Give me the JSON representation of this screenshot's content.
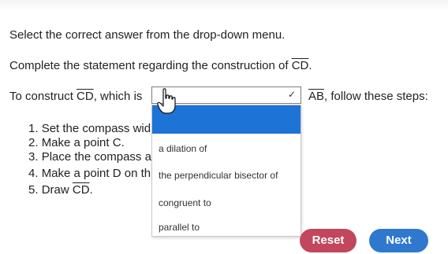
{
  "question": {
    "instruction": "Select the correct answer from the drop-down menu.",
    "statement_prefix": "Complete the statement regarding the construction of ",
    "statement_segment": "CD",
    "statement_suffix": ".",
    "sentence_prefix": "To construct ",
    "sentence_segment": "CD",
    "sentence_mid": ", which is",
    "sentence_segment2": "AB",
    "sentence_suffix": ", follow these steps:"
  },
  "steps": [
    {
      "num": "1.",
      "text": "Set the compass wid"
    },
    {
      "num": "2.",
      "text": "Make a point C."
    },
    {
      "num": "3.",
      "text": "Place the compass a"
    },
    {
      "num": "4.",
      "text": "Make a point D on th"
    },
    {
      "num": "5.",
      "text_prefix": "Draw ",
      "text_segment": "CD",
      "text_suffix": "."
    }
  ],
  "dropdown": {
    "selected": "",
    "options": [
      "a dilation of",
      "the perpendicular bisector of",
      "congruent to",
      "parallel to"
    ]
  },
  "buttons": {
    "reset": "Reset",
    "next": "Next"
  },
  "colors": {
    "highlight": "#1e73d6",
    "reset": "#c2465c",
    "next": "#2f78cf"
  }
}
